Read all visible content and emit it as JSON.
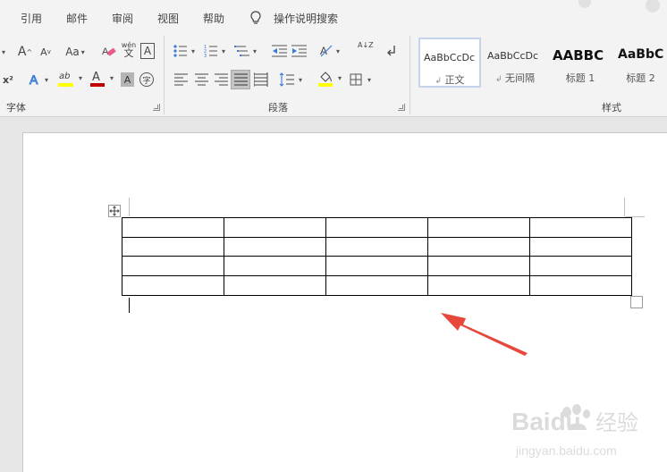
{
  "menu": {
    "tabs": [
      "引用",
      "邮件",
      "审阅",
      "视图",
      "帮助"
    ],
    "tellme": "操作说明搜索"
  },
  "font_group": {
    "label": "字体",
    "change_case": "Aa",
    "superscript": "x²",
    "grow_font": "A",
    "shrink_font": "A",
    "phonetic_top": "wén",
    "phonetic_bottom": "文",
    "char_border": "A",
    "font_color": "A",
    "char_shading": "A",
    "enclose": "字",
    "highlight": "ab"
  },
  "paragraph_group": {
    "label": "段落",
    "sort": "A↓Z"
  },
  "styles_group": {
    "label": "样式",
    "styles": [
      {
        "sample": "AaBbCcDc",
        "name": "正文",
        "mark": "↲"
      },
      {
        "sample": "AaBbCcDc",
        "name": "无间隔",
        "mark": "↲"
      },
      {
        "sample": "AABBC",
        "name": "标题 1",
        "mark": ""
      },
      {
        "sample": "AaBbC",
        "name": "标题 2",
        "mark": ""
      }
    ]
  },
  "document": {
    "table": {
      "rows": 4,
      "cols": 5
    }
  },
  "watermark": {
    "brand": "Baidu",
    "subtitle": "经验",
    "url": "jingyan.baidu.com"
  },
  "colors": {
    "accent": "#2b579a",
    "font_red": "#c00000",
    "highlight_yellow": "#ffff00",
    "arrow": "#e8473c"
  }
}
